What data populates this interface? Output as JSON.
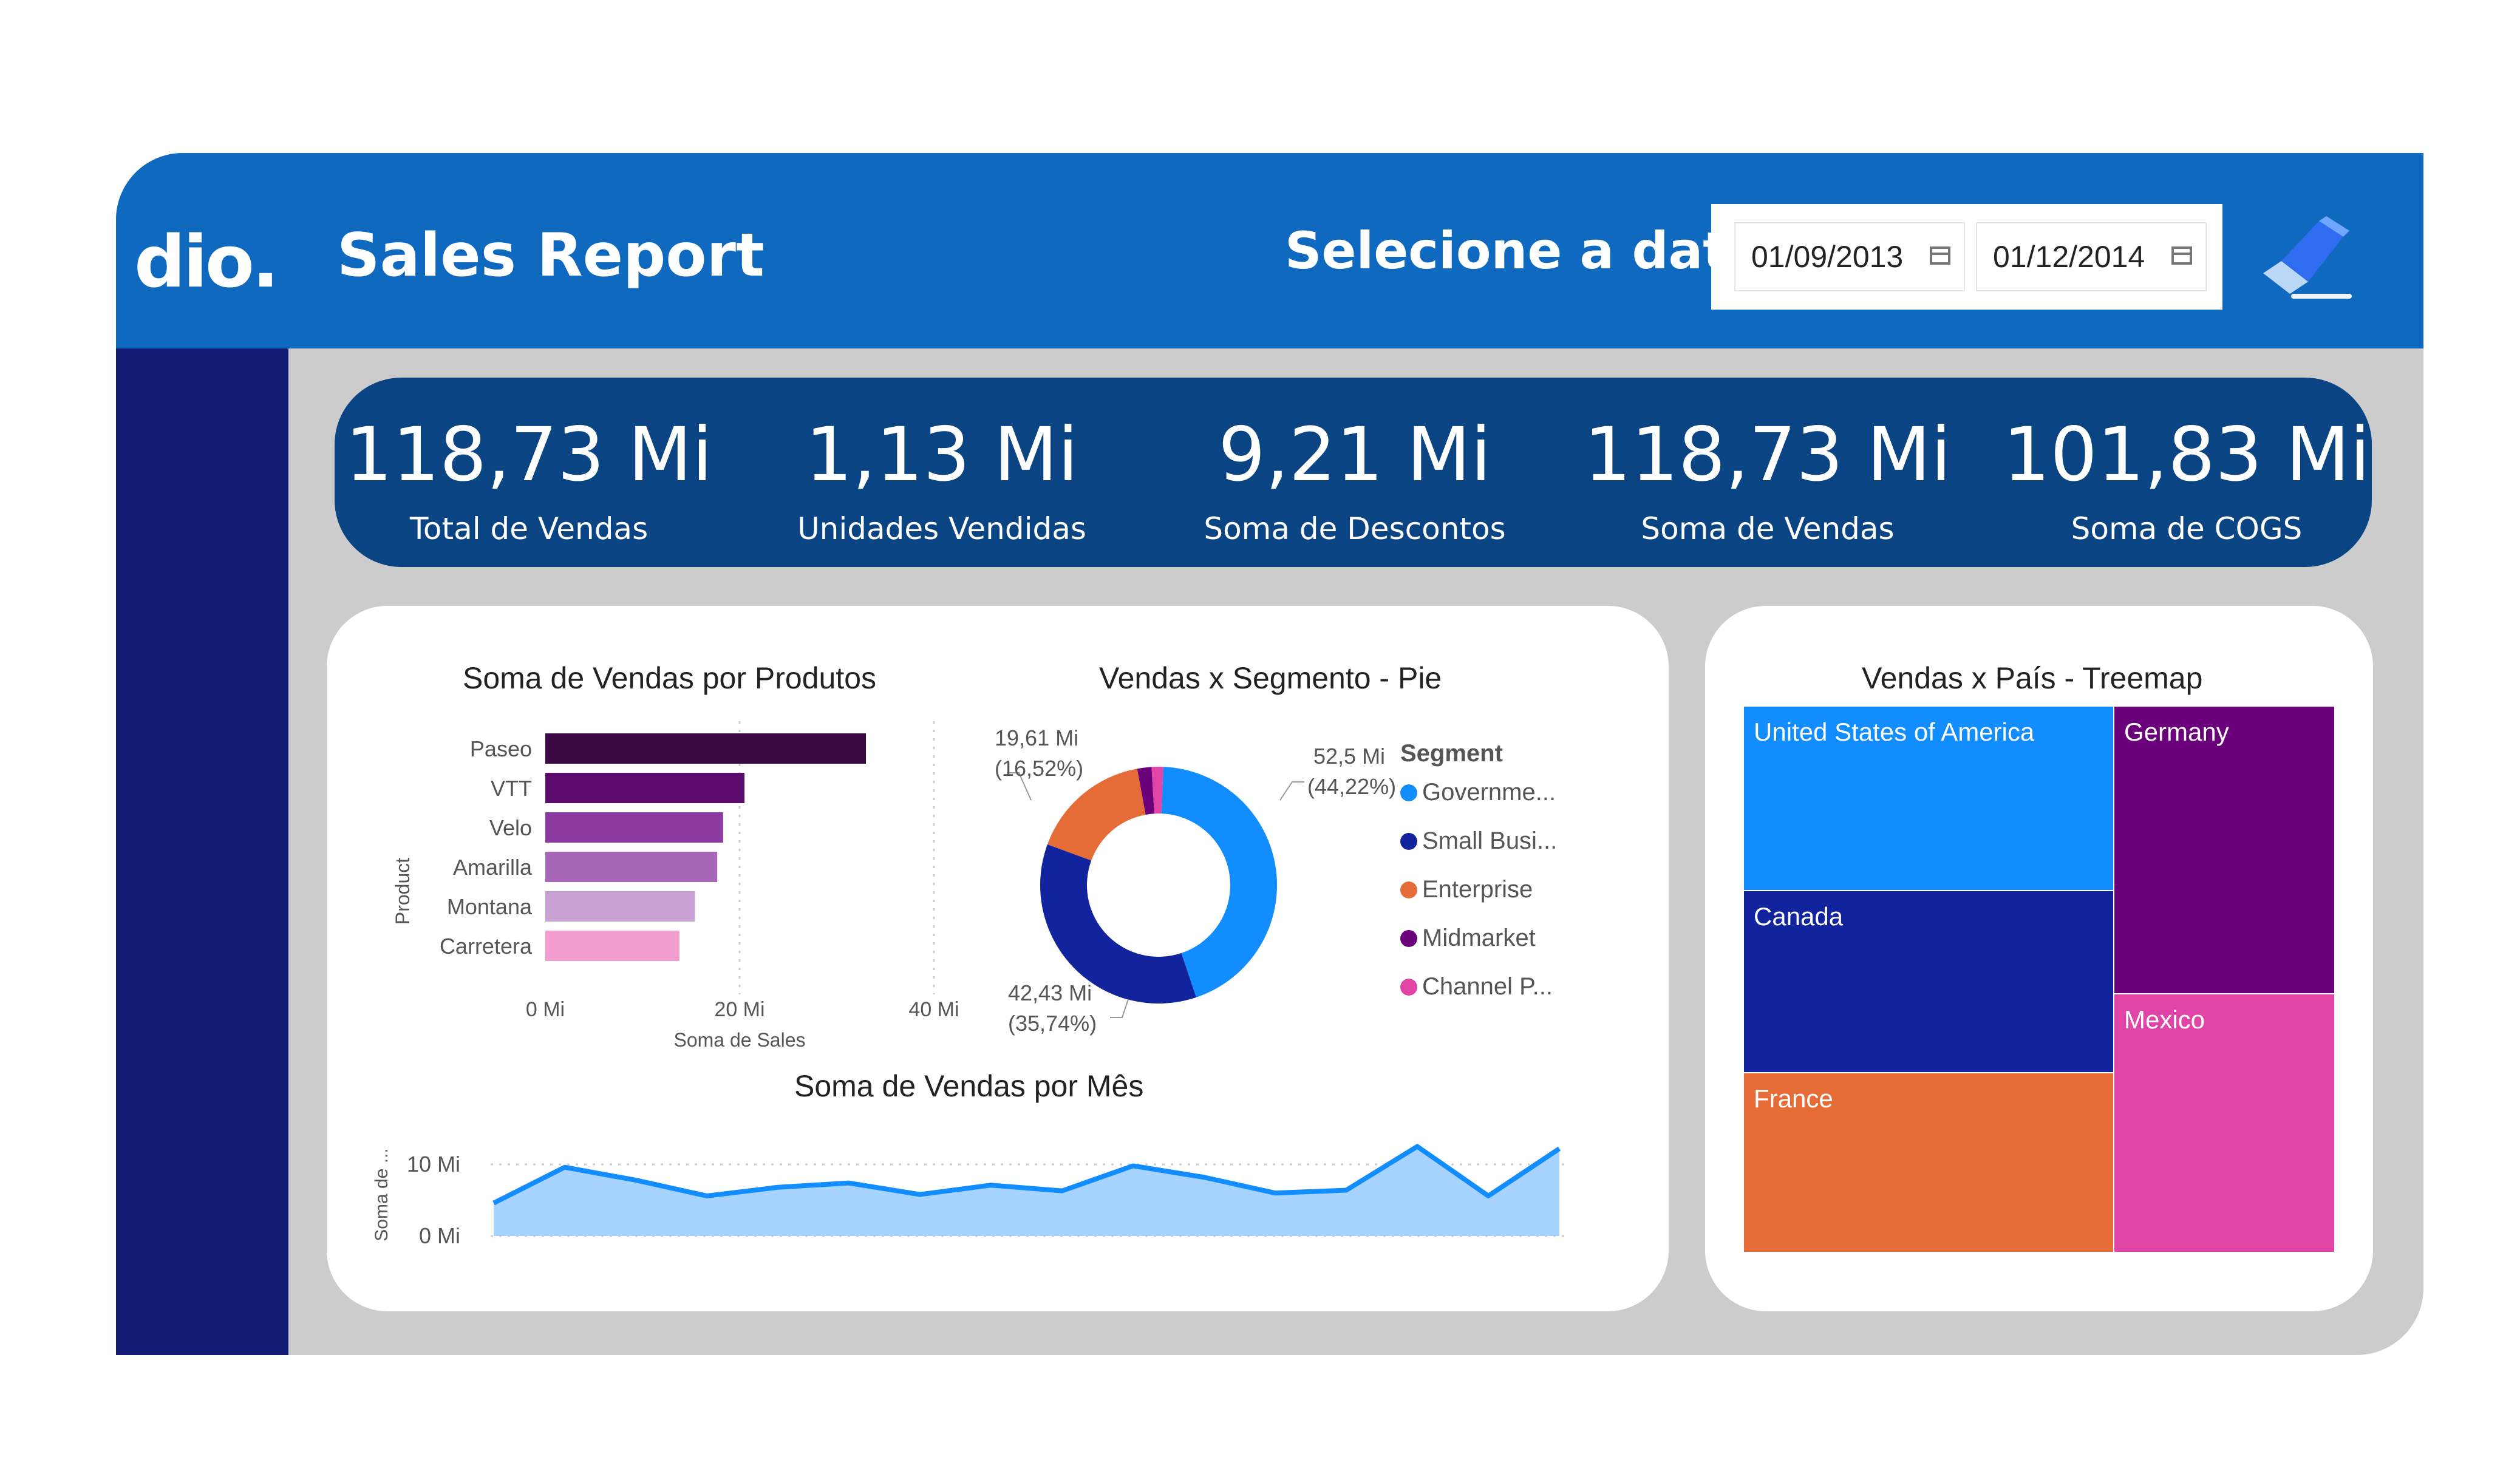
{
  "header": {
    "logo_text": "dio.",
    "title": "Sales Report",
    "date_label": "Selecione a data",
    "date_start": "01/09/2013",
    "date_end": "01/12/2014"
  },
  "kpis": [
    {
      "value": "118,73 Mi",
      "label": "Total de Vendas"
    },
    {
      "value": "1,13 Mi",
      "label": "Unidades Vendidas"
    },
    {
      "value": "9,21 Mi",
      "label": "Soma de Descontos"
    },
    {
      "value": "118,73 Mi",
      "label": "Soma de Vendas"
    },
    {
      "value": "101,83 Mi",
      "label": "Soma de COGS"
    }
  ],
  "chart_data": [
    {
      "type": "bar",
      "orientation": "horizontal",
      "title": "Soma de Vendas por Produtos",
      "xlabel": "Soma de Sales",
      "ylabel": "Product",
      "categories": [
        "Paseo",
        "VTT",
        "Velo",
        "Amarilla",
        "Montana",
        "Carretera"
      ],
      "values": [
        33.0,
        20.5,
        18.3,
        17.7,
        15.4,
        13.8
      ],
      "xlim": [
        0,
        40
      ],
      "xticks": [
        "0 Mi",
        "20 Mi",
        "40 Mi"
      ],
      "colors": [
        "#3b0a45",
        "#5c0c6e",
        "#8a3aa0",
        "#a667b8",
        "#c7a0d2",
        "#f29ccf"
      ]
    },
    {
      "type": "pie",
      "title": "Vendas x Segmento - Pie",
      "legend_title": "Segment",
      "legend": [
        "Governme...",
        "Small Busi...",
        "Enterprise",
        "Midmarket",
        "Channel P..."
      ],
      "values": [
        52.5,
        42.43,
        19.61,
        2.31,
        1.88
      ],
      "colors": [
        "#118dff",
        "#12239e",
        "#e66c37",
        "#6b007b",
        "#e044a7"
      ],
      "labels": [
        {
          "value": "52,5 Mi",
          "pct": "(44,22%)"
        },
        {
          "value": "42,43 Mi",
          "pct": "(35,74%)"
        },
        {
          "value": "19,61 Mi",
          "pct": "(16,52%)"
        }
      ]
    },
    {
      "type": "area",
      "title": "Soma de Vendas por Mês",
      "ylabel": "Soma de ...",
      "yticks": [
        "10 Mi",
        "0 Mi"
      ],
      "ylim": [
        0,
        12
      ],
      "values": [
        4.6,
        9.6,
        7.8,
        5.6,
        6.8,
        7.4,
        5.8,
        7.1,
        6.3,
        9.8,
        8.2,
        6.0,
        6.4,
        12.5,
        5.6,
        12.2
      ],
      "color": "#118dff",
      "fill": "#a6d3ff"
    },
    {
      "type": "treemap",
      "title": "Vendas x País - Treemap",
      "items": [
        {
          "label": "United States of America",
          "color": "#118dff"
        },
        {
          "label": "Canada",
          "color": "#12239e"
        },
        {
          "label": "France",
          "color": "#e66c37"
        },
        {
          "label": "Germany",
          "color": "#6b007b"
        },
        {
          "label": "Mexico",
          "color": "#e044a7"
        }
      ]
    }
  ]
}
